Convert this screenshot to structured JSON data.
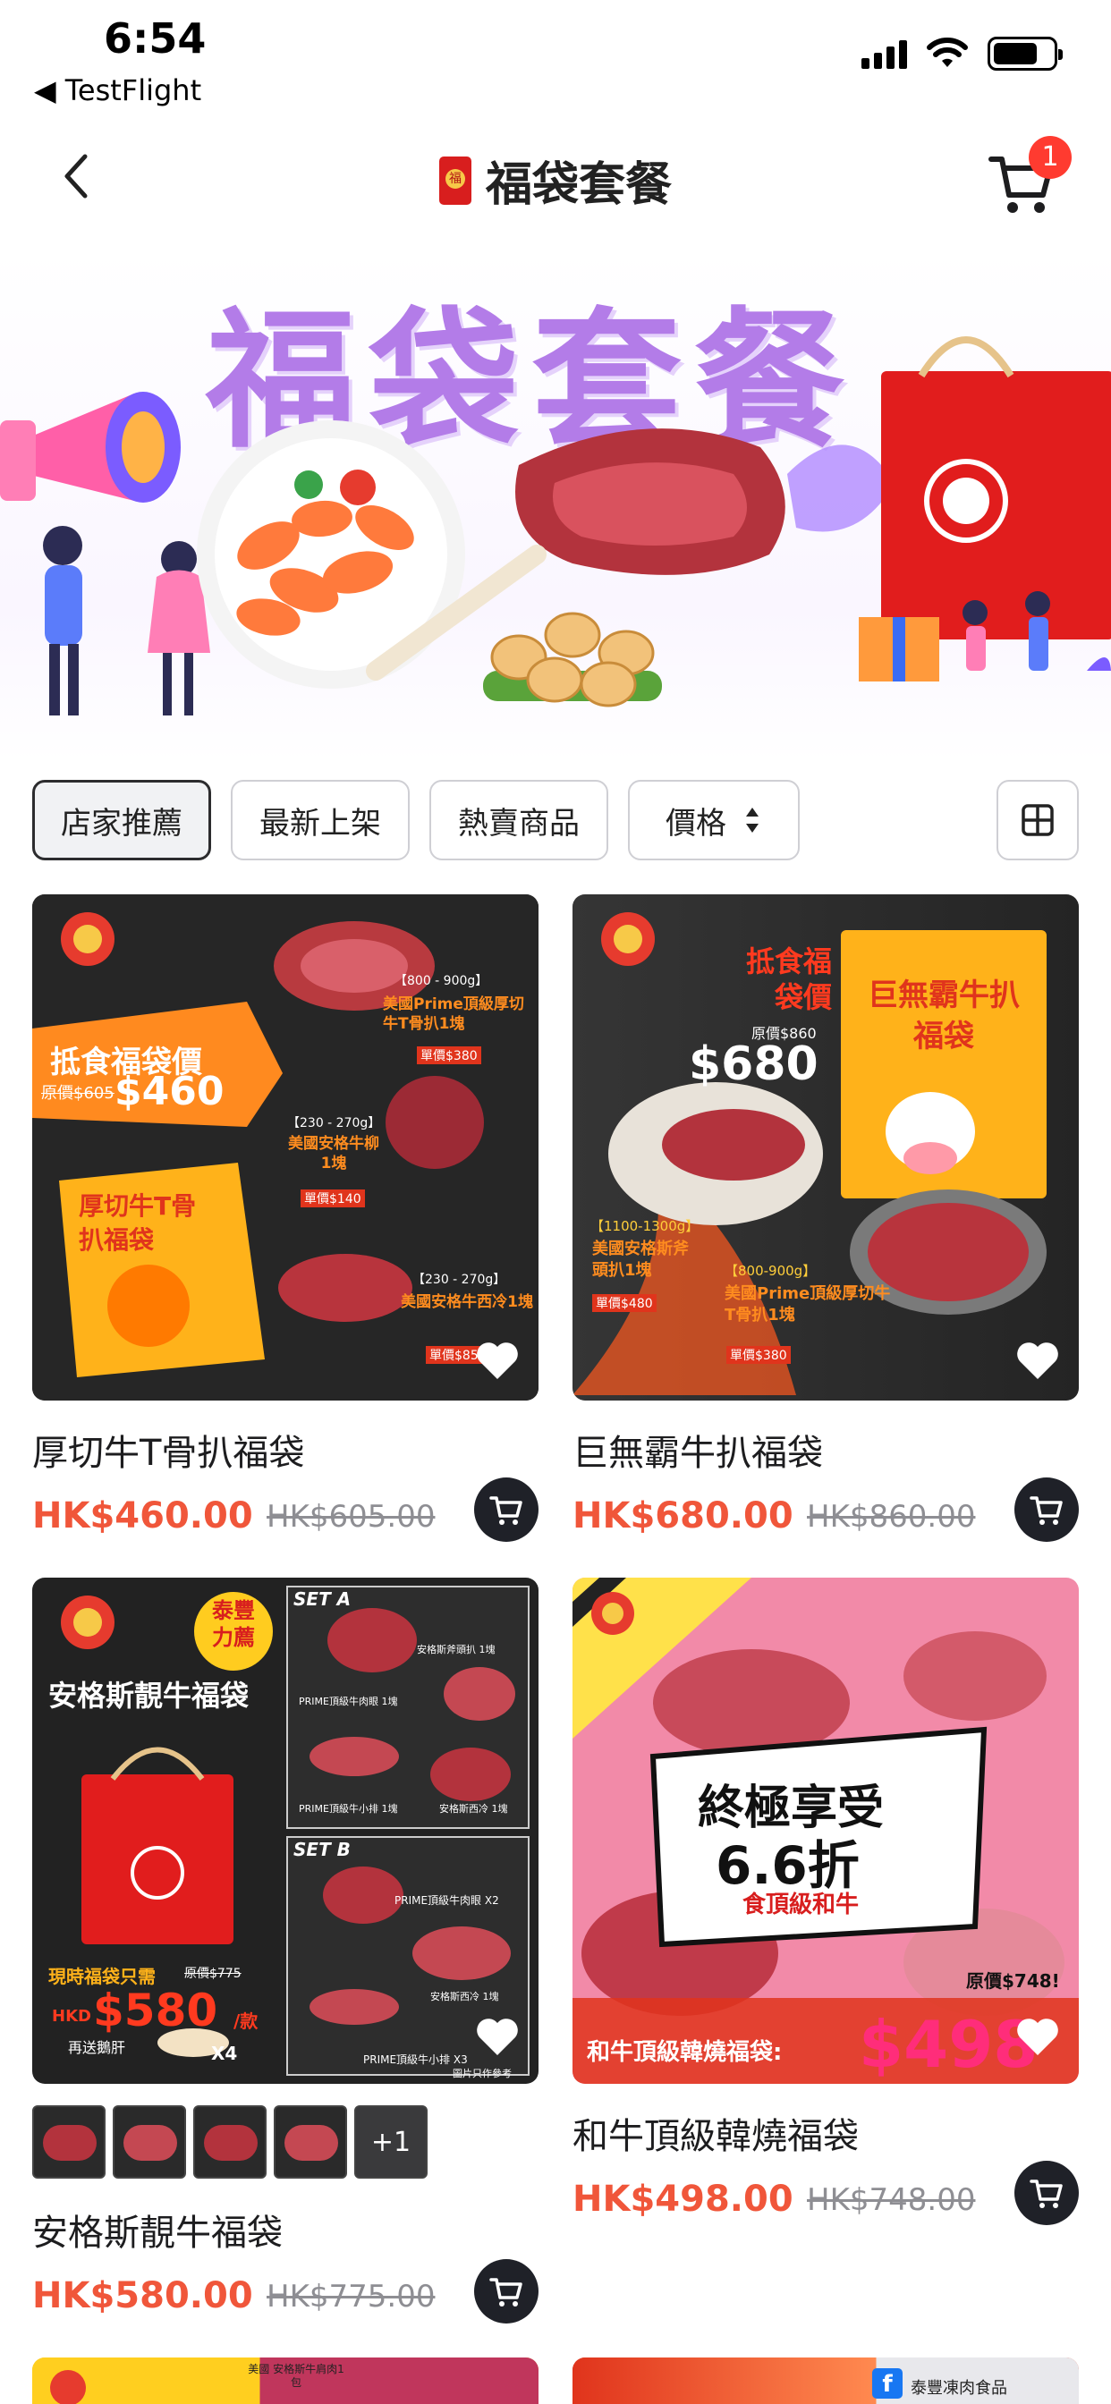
{
  "status_bar": {
    "time": "6:54",
    "back_app": "◀ TestFlight"
  },
  "header": {
    "title": "福袋套餐",
    "cart_count": "1"
  },
  "banner": {
    "title": "福袋套餐"
  },
  "filters": {
    "chips": [
      "店家推薦",
      "最新上架",
      "熱賣商品",
      "價格"
    ]
  },
  "products": [
    {
      "name": "厚切牛T骨扒福袋",
      "price": "HK$460.00",
      "original_price": "HK$605.00",
      "poster": {
        "headline": "抵食福袋價",
        "orig": "原價$605",
        "price": "$460",
        "bag": "厚切牛T骨扒福袋",
        "item1_weight": "【800 - 900g】",
        "item1": "美國Prime頂級厚切牛T骨扒1塊",
        "item1_price": "單價$380",
        "item2_weight": "【230 - 270g】",
        "item2": "美國安格牛柳1塊",
        "item2_price": "單價$140",
        "item3_weight": "【230 - 270g】",
        "item3": "美國安格牛西冷1塊",
        "item3_price": "單價$85"
      }
    },
    {
      "name": "巨無霸牛扒福袋",
      "price": "HK$680.00",
      "original_price": "HK$860.00",
      "poster": {
        "headline": "抵食福袋價",
        "orig": "原價$860",
        "price": "$680",
        "bag": "巨無霸牛扒福袋",
        "item1_weight": "【1100-1300g】",
        "item1": "美國安格斯斧頭扒1塊",
        "item1_price": "單價$480",
        "item2_weight": "【800-900g】",
        "item2": "美國Prime頂級厚切牛T骨扒1塊",
        "item2_price": "單價$380"
      }
    },
    {
      "name": "安格斯靚牛福袋",
      "price": "HK$580.00",
      "original_price": "HK$775.00",
      "thumbs_more": "+1",
      "poster": {
        "tag": "泰豐力薦",
        "headline": "安格斯靚牛福袋",
        "set_a": "SET A",
        "set_b": "SET B",
        "a1": "安格斯斧頭扒 1塊",
        "a2": "PRIME頂級牛肉眼 1塊",
        "a3": "PRIME頂級牛小排 1塊",
        "a4": "安格斯西冷 1塊",
        "b1": "PRIME頂級牛肉眼 X2",
        "b2": "安格斯西冷 1塊",
        "b3": "PRIME頂級牛小排 X3",
        "offer": "現時福袋只需",
        "orig": "原價$775",
        "price_prefix": "HKD",
        "price": "$580",
        "price_suffix": "/款",
        "gift": "再送鵝肝",
        "gift_qty": "X4",
        "note": "圖片只作參考"
      }
    },
    {
      "name": "和牛頂級韓燒福袋",
      "price": "HK$498.00",
      "original_price": "HK$748.00",
      "poster": {
        "headline": "終極享受",
        "discount": "6.6折",
        "sub": "食頂級和牛",
        "orig": "原價$748!",
        "bottom": "和牛頂級韓燒福袋:",
        "price": "$498"
      }
    }
  ],
  "peek": {
    "left_label": "美國 安格斯牛肩肉1包",
    "right_label": "泰豐凍肉食品"
  },
  "colors": {
    "accent": "#f0563a",
    "brand_red": "#d81e1e",
    "dark_button": "#1f2128"
  }
}
